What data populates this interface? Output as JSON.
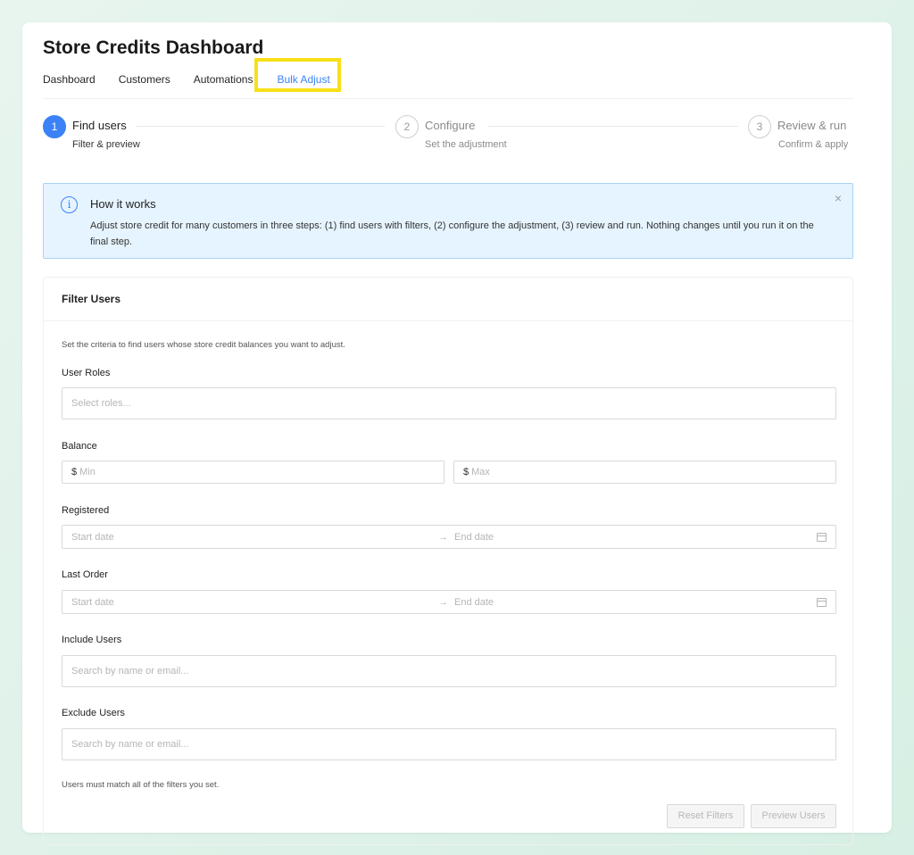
{
  "header": {
    "title": "Store Credits Dashboard"
  },
  "tabs": [
    {
      "label": "Dashboard"
    },
    {
      "label": "Customers"
    },
    {
      "label": "Automations"
    },
    {
      "label": "Bulk Adjust",
      "active": true
    }
  ],
  "steps": [
    {
      "number": "1",
      "title": "Find users",
      "description": "Filter & preview",
      "state": "active"
    },
    {
      "number": "2",
      "title": "Configure",
      "description": "Set the adjustment",
      "state": "pending"
    },
    {
      "number": "3",
      "title": "Review & run",
      "description": "Confirm & apply",
      "state": "pending"
    }
  ],
  "info": {
    "icon": "info-icon",
    "title": "How it works",
    "text": "Adjust store credit for many customers in three steps: (1) find users with filters, (2) configure the adjustment, (3) review and run. Nothing changes until you run it on the final step.",
    "close_icon": "close-icon"
  },
  "filter": {
    "title": "Filter Users",
    "hint": "Set the criteria to find users whose store credit balances you want to adjust.",
    "user_roles": {
      "label": "User Roles",
      "placeholder": "Select roles..."
    },
    "balance": {
      "label": "Balance",
      "min_prefix": "$",
      "min_placeholder": "Min",
      "max_prefix": "$",
      "max_placeholder": "Max"
    },
    "registered": {
      "label": "Registered",
      "start_placeholder": "Start date",
      "end_placeholder": "End date",
      "arrow": "→"
    },
    "last_order": {
      "label": "Last Order",
      "start_placeholder": "Start date",
      "end_placeholder": "End date",
      "arrow": "→"
    },
    "include_users": {
      "label": "Include Users",
      "placeholder": "Search by name or email..."
    },
    "exclude_users": {
      "label": "Exclude Users",
      "placeholder": "Search by name or email..."
    },
    "footnote": "Users must match all of the filters you set.",
    "reset_label": "Reset Filters",
    "preview_label": "Preview Users"
  },
  "colors": {
    "accent": "#3b82f6",
    "highlight": "#f7e017",
    "info_bg": "#e6f4ff"
  }
}
